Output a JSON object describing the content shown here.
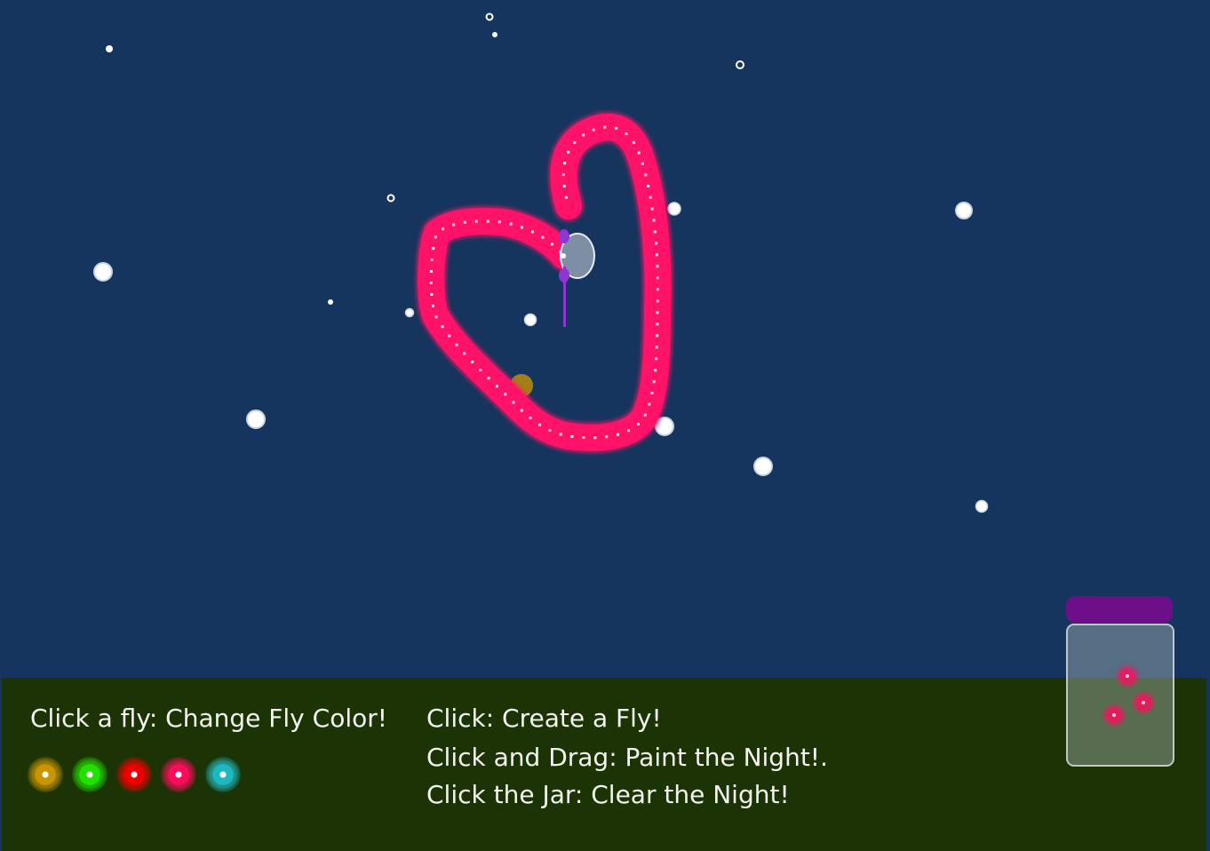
{
  "instructions": {
    "change_color": "Click a fly: Change Fly Color!",
    "create_fly": "Click: Create a Fly!",
    "paint_night": "Click and Drag: Paint the Night!.",
    "clear_night": "Click the Jar: Clear the Night!"
  },
  "fly_colors": [
    {
      "name": "gold",
      "color": "#c99500"
    },
    {
      "name": "green",
      "color": "#22e000"
    },
    {
      "name": "red",
      "color": "#ee0000"
    },
    {
      "name": "pink",
      "color": "#ff0b5e"
    },
    {
      "name": "teal",
      "color": "#1fb8c0"
    }
  ],
  "colors": {
    "sky": "#15355e",
    "ground": "#1b3305",
    "paint_stroke": "#ff1368",
    "moon": "#ffffff",
    "jar_lid": "#6c0f88",
    "active_fly": "#8e35d6",
    "gold_fly": "#c99500"
  },
  "jar": {
    "fly_count": 3,
    "fly_color": "#ff0b5e"
  }
}
